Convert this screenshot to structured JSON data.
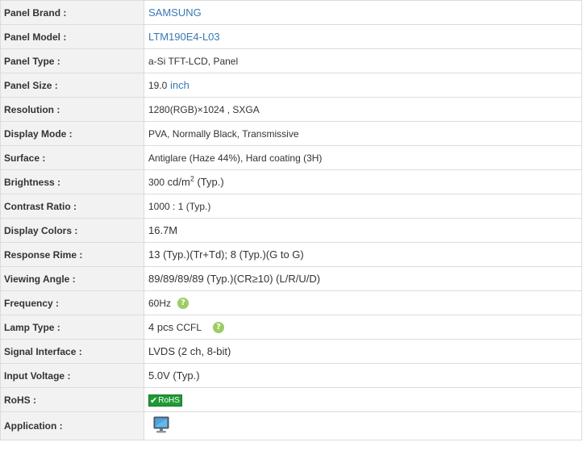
{
  "rows": {
    "brand": {
      "label": "Panel Brand :",
      "value": "SAMSUNG"
    },
    "model": {
      "label": "Panel Model :",
      "value": "LTM190E4-L03"
    },
    "type": {
      "label": "Panel Type :",
      "value": "a-Si TFT-LCD, Panel"
    },
    "size": {
      "label": "Panel Size :",
      "value": "19.0",
      "unit": "inch"
    },
    "resolution": {
      "label": "Resolution :",
      "value": "1280(RGB)×1024 , SXGA"
    },
    "display_mode": {
      "label": "Display Mode :",
      "value": "PVA, Normally Black, Transmissive"
    },
    "surface": {
      "label": "Surface :",
      "value": "Antiglare (Haze 44%), Hard coating (3H)"
    },
    "brightness": {
      "label": "Brightness :",
      "value": "300",
      "unit": "cd/m",
      "unit_sup": "2",
      "suffix": " (Typ.)"
    },
    "contrast": {
      "label": "Contrast Ratio :",
      "value": "1000 : 1 (Typ.)"
    },
    "colors": {
      "label": "Display Colors :",
      "value": "16.7M"
    },
    "response": {
      "label": "Response Rime :",
      "value": "13 (Typ.)(Tr+Td); 8 (Typ.)(G to G)"
    },
    "viewing": {
      "label": "Viewing Angle :",
      "value": "89/89/89/89 (Typ.)(CR≥10) (L/R/U/D)"
    },
    "frequency": {
      "label": "Frequency :",
      "value": "60Hz",
      "help": "?"
    },
    "lamp": {
      "label": "Lamp Type :",
      "value_prefix": "4 pcs",
      "value": "CCFL",
      "help": "?"
    },
    "signal": {
      "label": "Signal Interface :",
      "value": "LVDS (2 ch, 8-bit)"
    },
    "voltage": {
      "label": "Input Voltage :",
      "value": "5.0V (Typ.)"
    },
    "rohs": {
      "label": "RoHS :",
      "badge": "RoHS",
      "check": "✔"
    },
    "application": {
      "label": "Application :",
      "icon": "monitor-icon"
    }
  },
  "colors": {
    "link": "#3a78b5",
    "label_bg": "#f2f2f2",
    "border": "#dcdcdc",
    "help": "#9ccc65",
    "rohs": "#1e9a33"
  }
}
